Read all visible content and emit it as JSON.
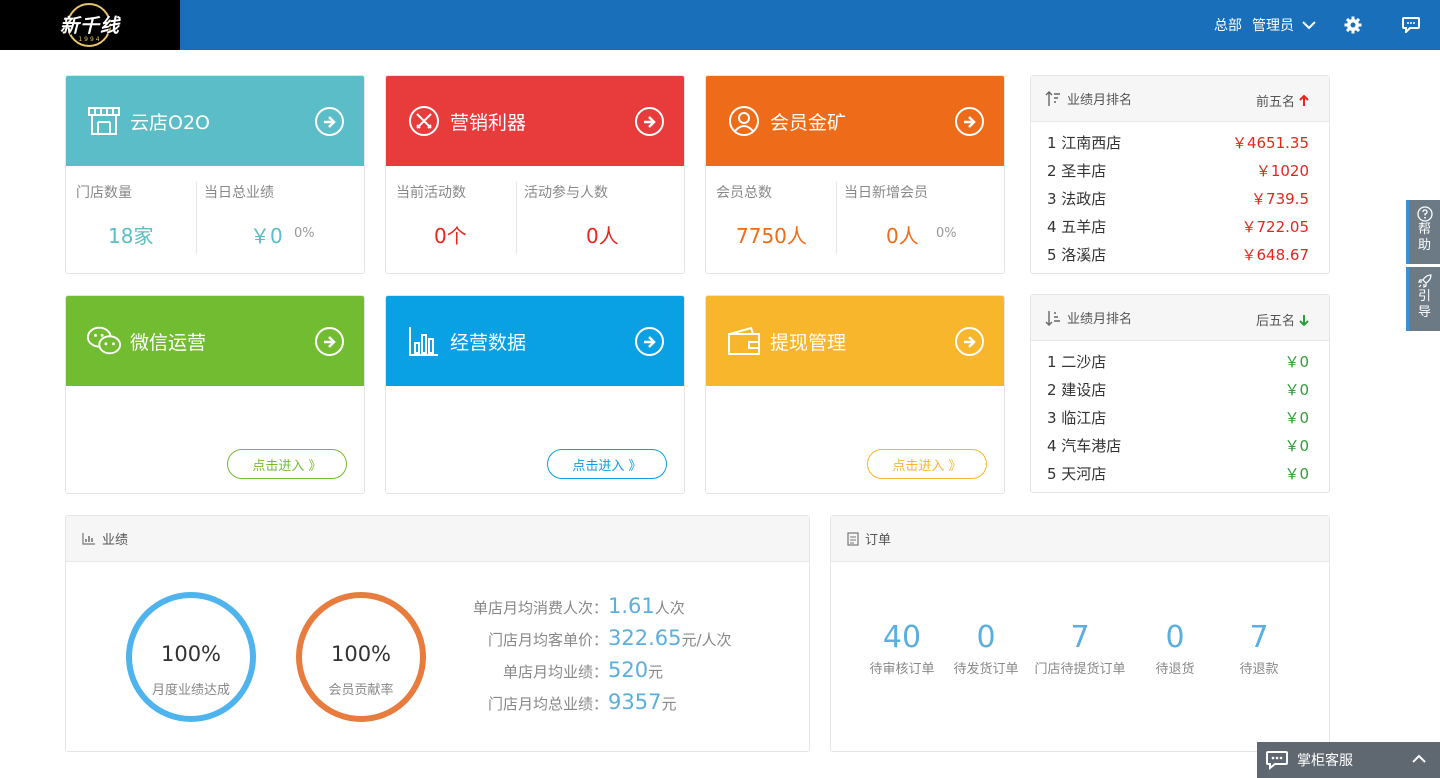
{
  "header": {
    "logo_text": "新千线",
    "logo_year": "1994",
    "hq": "总部",
    "admin": "管理员"
  },
  "colors": {
    "topbar": "#1a6fba",
    "cloud": "#5bbdc7",
    "marketing": "#e83b3b",
    "member": "#ee6b19",
    "wechat": "#72bc32",
    "data": "#09a0e4",
    "withdraw": "#f8b62d",
    "up_red": "#e8251c",
    "down_green": "#2e9e3a"
  },
  "cards": {
    "cloud": {
      "title": "云店O2O",
      "stat1_label": "门店数量",
      "stat1_value": "18家",
      "stat2_label": "当日总业绩",
      "stat2_value": "￥0",
      "stat2_pct": "0%"
    },
    "marketing": {
      "title": "营销利器",
      "stat1_label": "当前活动数",
      "stat1_value": "0个",
      "stat2_label": "活动参与人数",
      "stat2_value": "0人"
    },
    "member": {
      "title": "会员金矿",
      "stat1_label": "会员总数",
      "stat1_value": "7750人",
      "stat2_label": "当日新增会员",
      "stat2_value": "0人",
      "stat2_pct": "0%"
    },
    "wechat": {
      "title": "微信运营",
      "enter": "点击进入 》"
    },
    "data": {
      "title": "经营数据",
      "enter": "点击进入 》"
    },
    "withdraw": {
      "title": "提现管理",
      "enter": "点击进入 》"
    }
  },
  "rank_top": {
    "title": "业绩月排名",
    "side": "前五名",
    "rows": [
      {
        "name": "1 江南西店",
        "amount": "￥4651.35"
      },
      {
        "name": "2 圣丰店",
        "amount": "￥1020"
      },
      {
        "name": "3 法政店",
        "amount": "￥739.5"
      },
      {
        "name": "4 五羊店",
        "amount": "￥722.05"
      },
      {
        "name": "5 洛溪店",
        "amount": "￥648.67"
      }
    ]
  },
  "rank_bottom": {
    "title": "业绩月排名",
    "side": "后五名",
    "rows": [
      {
        "name": "1 二沙店",
        "amount": "￥0"
      },
      {
        "name": "2 建设店",
        "amount": "￥0"
      },
      {
        "name": "3 临江店",
        "amount": "￥0"
      },
      {
        "name": "4 汽车港店",
        "amount": "￥0"
      },
      {
        "name": "5 天河店",
        "amount": "￥0"
      }
    ]
  },
  "performance": {
    "title": "业绩",
    "circle1": {
      "value": "100%",
      "label": "月度业绩达成",
      "fraction": 1.0
    },
    "circle2": {
      "value": "100%",
      "label": "会员贡献率",
      "fraction": 1.0
    },
    "metrics": [
      {
        "label": "单店月均消费人次：",
        "value": "1.61",
        "unit": "人次"
      },
      {
        "label": "门店月均客单价：",
        "value": "322.65",
        "unit": "元/人次"
      },
      {
        "label": "单店月均业绩：",
        "value": "520",
        "unit": "元"
      },
      {
        "label": "门店月均总业绩：",
        "value": "9357",
        "unit": "元"
      }
    ]
  },
  "orders": {
    "title": "订单",
    "items": [
      {
        "count": "40",
        "label": "待审核订单"
      },
      {
        "count": "0",
        "label": "待发货订单"
      },
      {
        "count": "7",
        "label": "门店待提货订单"
      },
      {
        "count": "0",
        "label": "待退货"
      },
      {
        "count": "7",
        "label": "待退款"
      }
    ]
  },
  "side_buttons": {
    "help1": "帮",
    "help2": "助",
    "guide1": "引",
    "guide2": "导"
  },
  "kefu": {
    "label": "掌柜客服"
  }
}
